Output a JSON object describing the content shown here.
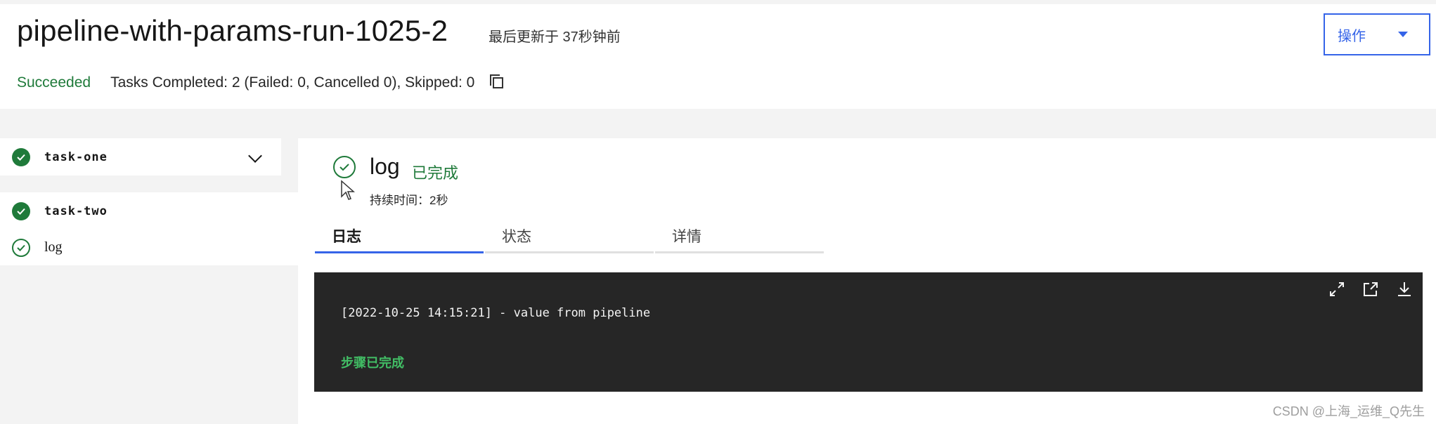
{
  "header": {
    "title": "pipeline-with-params-run-1025-2",
    "last_updated": "最后更新于 37秒钟前",
    "actions_label": "操作",
    "status": "Succeeded",
    "tasks_summary": "Tasks Completed: 2 (Failed: 0, Cancelled 0), Skipped: 0"
  },
  "sidebar": {
    "items": [
      {
        "label": "task-one",
        "status": "succeeded",
        "expandable": true
      },
      {
        "label": "task-two",
        "status": "succeeded"
      },
      {
        "label": "log",
        "status": "succeeded",
        "selected": true
      }
    ]
  },
  "detail": {
    "title": "log",
    "state": "已完成",
    "duration": "持续时间：2秒",
    "tabs": [
      {
        "label": "日志",
        "active": true
      },
      {
        "label": "状态",
        "active": false
      },
      {
        "label": "详情",
        "active": false
      }
    ],
    "log": {
      "lines": [
        "[2022-10-25 14:15:21] - value from pipeline"
      ],
      "completion": "步骤已完成",
      "tools": [
        "maximize-icon",
        "open-external-icon",
        "download-icon"
      ]
    }
  },
  "colors": {
    "success": "#1f7a3a",
    "accent": "#3564e8",
    "log_bg": "#262626",
    "log_success": "#42be65"
  },
  "watermark": "CSDN @上海_运维_Q先生"
}
